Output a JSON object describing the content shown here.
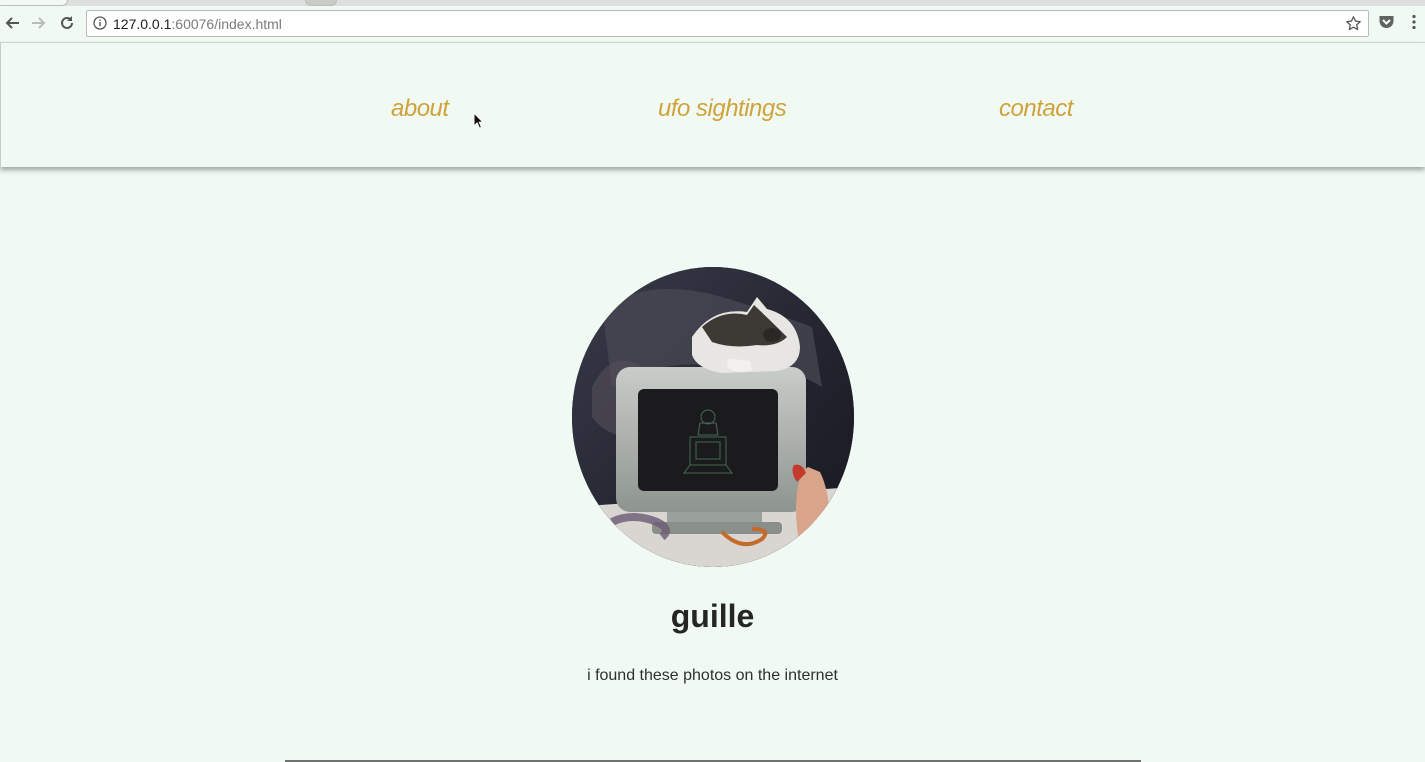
{
  "browser": {
    "url_host": "127.0.0.1",
    "url_path": ":60076/index.html",
    "icons": {
      "back": "back-arrow-icon",
      "forward": "forward-arrow-icon",
      "reload": "reload-icon",
      "info": "info-icon",
      "bookmark": "star-icon",
      "pocket": "pocket-icon",
      "menu": "more-vert-icon"
    }
  },
  "nav": {
    "items": [
      {
        "label": "about"
      },
      {
        "label": "ufo sightings"
      },
      {
        "label": "contact"
      }
    ],
    "link_color": "#d0a23c"
  },
  "profile": {
    "name": "guille",
    "bio": "i found these photos on the internet",
    "avatar": "cat-on-computer-photo"
  },
  "colors": {
    "page_background": "#f0faf3",
    "text": "#252525"
  }
}
